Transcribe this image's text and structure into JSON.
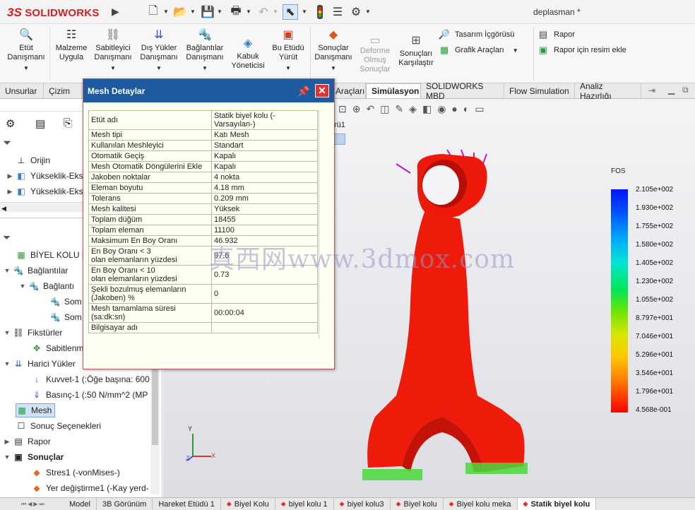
{
  "app": {
    "logo_prefix": "3S",
    "logo_text": "SOLIDWORKS",
    "document_title": "deplasman *"
  },
  "ribbon": {
    "buttons": [
      {
        "label": "Etüt Danışmanı",
        "icon": "study-advisor-icon"
      },
      {
        "label": "Malzeme Uygula",
        "icon": "material-icon"
      },
      {
        "label": "Sabitleyici Danışmanı",
        "icon": "fixture-icon"
      },
      {
        "label": "Dış Yükler Danışmanı",
        "icon": "external-loads-icon"
      },
      {
        "label": "Bağlantılar Danışmanı",
        "icon": "connections-icon"
      },
      {
        "label": "Kabuk Yöneticisi",
        "icon": "shell-manager-icon"
      },
      {
        "label": "Bu Etüdü Yürüt",
        "icon": "run-study-icon"
      },
      {
        "label": "Sonuçlar Danışmanı",
        "icon": "results-advisor-icon"
      },
      {
        "label": "Deforme Olmuş Sonuçlar",
        "icon": "deformed-results-icon"
      },
      {
        "label": "Sonuçları Karşılaştır",
        "icon": "compare-results-icon"
      }
    ],
    "right_items": [
      "Tasarım İçgörüsü",
      "Grafik Araçları",
      "Rapor",
      "Rapor için resim ekle"
    ]
  },
  "tabs": [
    "Unsurlar",
    "Çizim",
    "Araçları",
    "Simülasyon",
    "SOLIDWORKS MBD",
    "Flow Simulation",
    "Analiz Hazırlığı"
  ],
  "active_tab": "Simülasyon",
  "feature_tree_top": [
    "Orijin",
    "Yükseklik-Eks",
    "Yükseklik-Eks"
  ],
  "sim_tree": [
    {
      "label": "BİYEL KOLU N",
      "level": 0,
      "icon": "study-icon"
    },
    {
      "label": "Bağlantılar",
      "level": 0,
      "icon": "connections-icon"
    },
    {
      "label": "Bağlantı",
      "level": 1,
      "icon": "connector-icon"
    },
    {
      "label": "Som",
      "level": 2,
      "icon": "bolt-icon"
    },
    {
      "label": "Som",
      "level": 2,
      "icon": "bolt-icon"
    },
    {
      "label": "Fikstürler",
      "level": 0,
      "icon": "fixture-icon"
    },
    {
      "label": "Sabitlenm",
      "level": 1,
      "icon": "fixed-icon"
    },
    {
      "label": "Harici Yükler",
      "level": 0,
      "icon": "loads-icon"
    },
    {
      "label": "Kuvvet-1 (:Öğe başına: 600",
      "level": 1,
      "icon": "force-icon"
    },
    {
      "label": "Basınç-1 (:50 N/mm^2 (MP",
      "level": 1,
      "icon": "pressure-icon"
    },
    {
      "label": "Mesh",
      "level": 0,
      "icon": "mesh-icon",
      "selected": true
    },
    {
      "label": "Sonuç Seçenekleri",
      "level": 0,
      "icon": "result-options-icon"
    },
    {
      "label": "Rapor",
      "level": 0,
      "icon": "report-icon"
    },
    {
      "label": "Sonuçlar",
      "level": 0,
      "icon": "results-icon",
      "bold": true
    },
    {
      "label": "Stres1 (-vonMises-)",
      "level": 1,
      "icon": "stress-plot-icon"
    },
    {
      "label": "Yer değiştirme1 (-Kay yerd-",
      "level": 1,
      "icon": "displacement-plot-icon"
    }
  ],
  "dialog": {
    "title": "Mesh Detaylar",
    "rows": [
      {
        "k": "Etüt adı",
        "v": "Statik biyel kolu (-Varsayılan-)"
      },
      {
        "k": "Mesh tipi",
        "v": "Katı Mesh"
      },
      {
        "k": "Kullanılan Meshleyici",
        "v": "Standart"
      },
      {
        "k": "Otomatik Geçiş",
        "v": "Kapalı"
      },
      {
        "k": "Mesh Otomatik Döngülerini Ekle",
        "v": "Kapalı"
      },
      {
        "k": "Jakoben noktalar",
        "v": "4 nokta"
      },
      {
        "k": "Eleman boyutu",
        "v": "4.18 mm"
      },
      {
        "k": "Tolerans",
        "v": "0.209 mm"
      },
      {
        "k": "Mesh kalitesi",
        "v": "Yüksek"
      },
      {
        "k": "Toplam düğüm",
        "v": "18455"
      },
      {
        "k": "Toplam eleman",
        "v": "11100"
      },
      {
        "k": "Maksimum En Boy Oranı",
        "v": "46.932"
      },
      {
        "k": "En Boy Oranı < 3\nolan elemanların yüzdesi",
        "v": "97.6"
      },
      {
        "k": "En Boy Oranı < 10\nolan elemanların yüzdesi",
        "v": "0.73"
      },
      {
        "k": "Şekli bozulmuş elemanların\n(Jakoben) %",
        "v": "0"
      },
      {
        "k": "Mesh tamamlama süresi (sa:dk:sn)",
        "v": "00:00:04"
      },
      {
        "k": "Bilgisayar adı",
        "v": ""
      }
    ]
  },
  "legend": {
    "title": "FOS",
    "values": [
      "2.105e+002",
      "1.930e+002",
      "1.755e+002",
      "1.580e+002",
      "1.405e+002",
      "1.230e+002",
      "1.055e+002",
      "8.797e+001",
      "7.046e+001",
      "5.296e+001",
      "3.546e+001",
      "1.796e+001",
      "4.568e-001"
    ]
  },
  "viewport": {
    "label_fragment": "rü1",
    "axes": {
      "x": "X",
      "y": "Y",
      "z": "Z"
    }
  },
  "watermark": "真西网www.3dmox.com",
  "bottom_tabs": [
    "Model",
    "3B Görünüm",
    "Hareket Etüdü 1",
    "Biyel Kolu",
    "biyel kolu 1",
    "biyel kolu3",
    "Biyel kolu",
    "Biyel kolu meka",
    "Statik biyel kolu"
  ],
  "bottom_active": "Statik biyel kolu",
  "colors": {
    "dialog_title_bg": "#1e5aa0",
    "part_red": "#f01a0a",
    "accent_red": "#d11f26"
  }
}
